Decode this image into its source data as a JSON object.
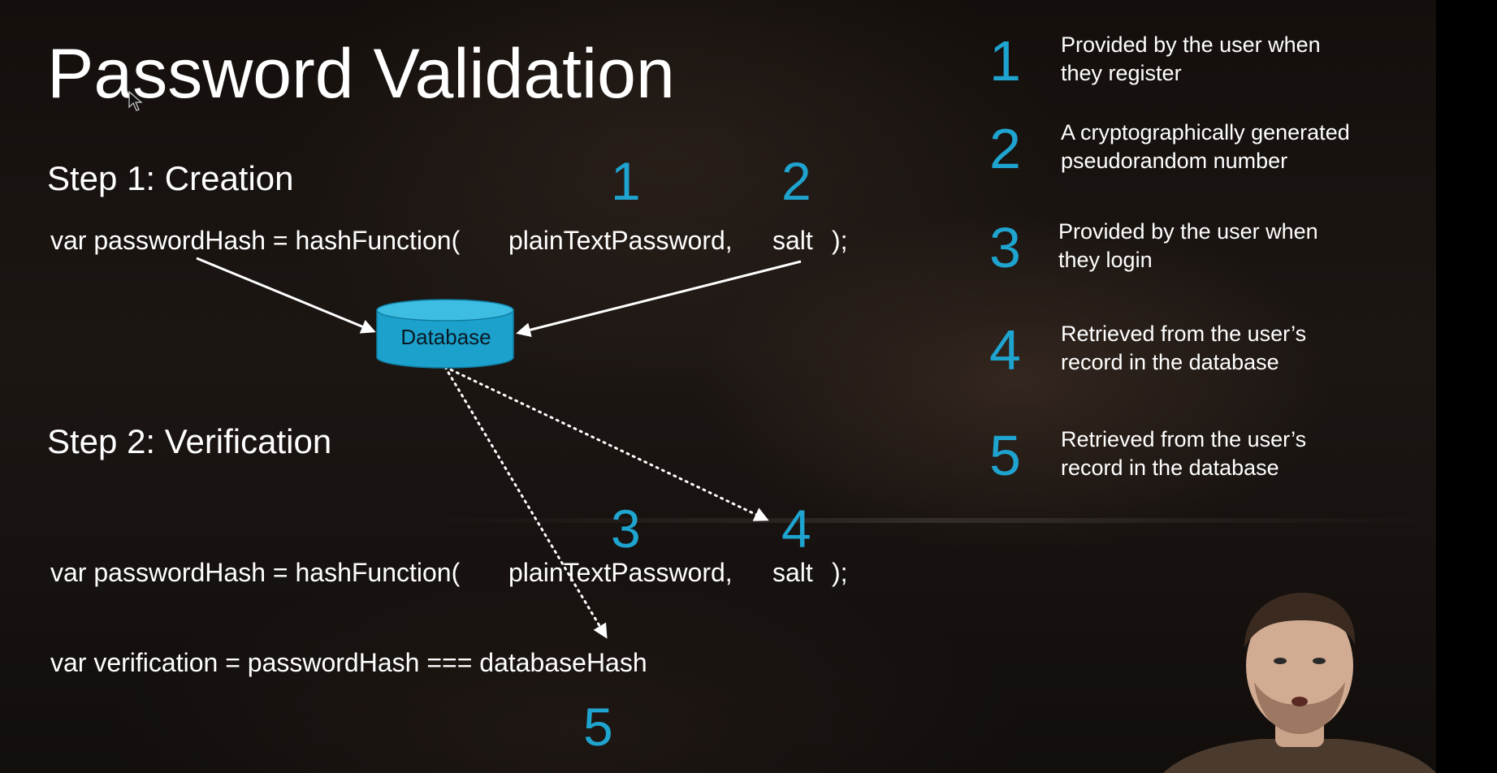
{
  "slide": {
    "title": "Password Validation",
    "step1": {
      "heading": "Step 1: Creation",
      "code": {
        "left": "var passwordHash = hashFunction(",
        "arg1": "plainTextPassword,",
        "arg2": "salt",
        "end": ");"
      },
      "marker1": "1",
      "marker2": "2"
    },
    "database_label": "Database",
    "step2": {
      "heading": "Step 2: Verification",
      "code": {
        "left": "var passwordHash = hashFunction(",
        "arg1": "plainTextPassword,",
        "arg2": "salt",
        "end": ");"
      },
      "verification": "var verification = passwordHash === databaseHash",
      "marker3": "3",
      "marker4": "4",
      "marker5": "5"
    },
    "legend": [
      {
        "num": "1",
        "line1": "Provided by the user when",
        "line2": "they register"
      },
      {
        "num": "2",
        "line1": "A cryptographically generated",
        "line2": "pseudorandom number"
      },
      {
        "num": "3",
        "line1": "Provided by the user when",
        "line2": "they login"
      },
      {
        "num": "4",
        "line1": "Retrieved from the user’s",
        "line2": "record in the database"
      },
      {
        "num": "5",
        "line1": "Retrieved from the user’s",
        "line2": "record in the database"
      }
    ],
    "colors": {
      "accent": "#1ea4cf",
      "database_fill": "#1ba1cc",
      "text": "#ffffff"
    },
    "icons": [
      "database-icon",
      "mouse-cursor-icon"
    ]
  }
}
